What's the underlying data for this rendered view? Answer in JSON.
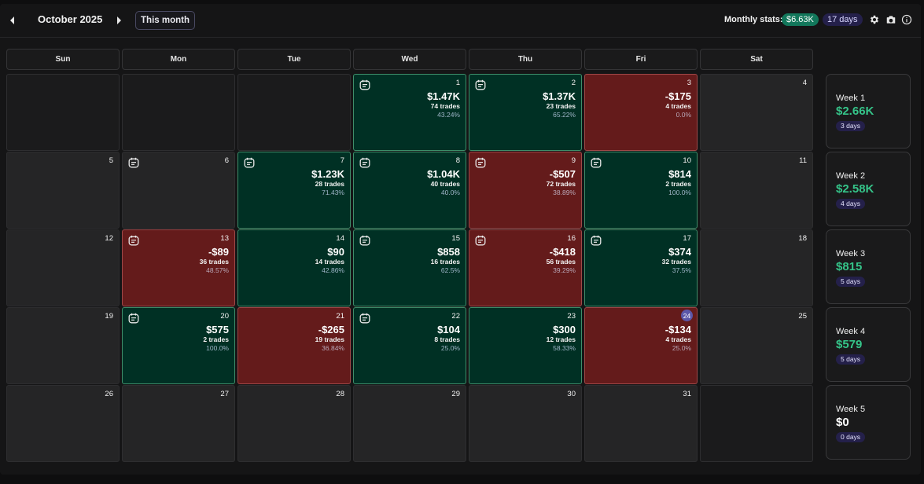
{
  "header": {
    "month_title": "October 2025",
    "this_month_label": "This month",
    "stats_label": "Monthly stats:",
    "stats_amount": "$6.63K",
    "stats_days": "17 days",
    "icons": [
      "caret-left-icon",
      "caret-right-icon",
      "gear-icon",
      "camera-icon",
      "info-icon"
    ]
  },
  "weekdays": [
    "Sun",
    "Mon",
    "Tue",
    "Wed",
    "Thu",
    "Fri",
    "Sat"
  ],
  "colors": {
    "profit_bg": "#003024",
    "loss_bg": "#641b1b",
    "profit_text": "#35c489",
    "badge_bg": "#24204a",
    "stats_pill_bg": "#12775b",
    "today_marker": "#5b57a8"
  },
  "weeks": [
    {
      "label": "Week 1",
      "amount": "$2.66K",
      "days": "3 days",
      "cells": [
        {
          "type": "blank"
        },
        {
          "type": "blank"
        },
        {
          "type": "blank"
        },
        {
          "type": "profit",
          "day": "1",
          "note": true,
          "pnl": "$1.47K",
          "trades": "74 trades",
          "winrate": "43.24%"
        },
        {
          "type": "profit",
          "day": "2",
          "note": true,
          "pnl": "$1.37K",
          "trades": "23 trades",
          "winrate": "65.22%"
        },
        {
          "type": "loss",
          "day": "3",
          "note": false,
          "pnl": "-$175",
          "trades": "4 trades",
          "winrate": "0.0%"
        },
        {
          "type": "empty",
          "day": "4"
        }
      ]
    },
    {
      "label": "Week 2",
      "amount": "$2.58K",
      "days": "4 days",
      "cells": [
        {
          "type": "empty",
          "day": "5"
        },
        {
          "type": "empty",
          "day": "6",
          "note": true
        },
        {
          "type": "profit",
          "day": "7",
          "note": true,
          "pnl": "$1.23K",
          "trades": "28 trades",
          "winrate": "71.43%"
        },
        {
          "type": "profit",
          "day": "8",
          "note": true,
          "pnl": "$1.04K",
          "trades": "40 trades",
          "winrate": "40.0%"
        },
        {
          "type": "loss",
          "day": "9",
          "note": true,
          "pnl": "-$507",
          "trades": "72 trades",
          "winrate": "38.89%"
        },
        {
          "type": "profit",
          "day": "10",
          "note": true,
          "pnl": "$814",
          "trades": "2 trades",
          "winrate": "100.0%"
        },
        {
          "type": "empty",
          "day": "11"
        }
      ]
    },
    {
      "label": "Week 3",
      "amount": "$815",
      "days": "5 days",
      "cells": [
        {
          "type": "empty",
          "day": "12"
        },
        {
          "type": "loss",
          "day": "13",
          "note": true,
          "pnl": "-$89",
          "trades": "36 trades",
          "winrate": "48.57%"
        },
        {
          "type": "profit",
          "day": "14",
          "note": false,
          "pnl": "$90",
          "trades": "14 trades",
          "winrate": "42.86%"
        },
        {
          "type": "profit",
          "day": "15",
          "note": true,
          "pnl": "$858",
          "trades": "16 trades",
          "winrate": "62.5%"
        },
        {
          "type": "loss",
          "day": "16",
          "note": true,
          "pnl": "-$418",
          "trades": "56 trades",
          "winrate": "39.29%"
        },
        {
          "type": "profit",
          "day": "17",
          "note": true,
          "pnl": "$374",
          "trades": "32 trades",
          "winrate": "37.5%"
        },
        {
          "type": "empty",
          "day": "18"
        }
      ]
    },
    {
      "label": "Week 4",
      "amount": "$579",
      "days": "5 days",
      "cells": [
        {
          "type": "empty",
          "day": "19"
        },
        {
          "type": "profit",
          "day": "20",
          "note": true,
          "pnl": "$575",
          "trades": "2 trades",
          "winrate": "100.0%"
        },
        {
          "type": "loss",
          "day": "21",
          "note": false,
          "pnl": "-$265",
          "trades": "19 trades",
          "winrate": "36.84%"
        },
        {
          "type": "profit",
          "day": "22",
          "note": true,
          "pnl": "$104",
          "trades": "8 trades",
          "winrate": "25.0%"
        },
        {
          "type": "profit",
          "day": "23",
          "note": false,
          "pnl": "$300",
          "trades": "12 trades",
          "winrate": "58.33%"
        },
        {
          "type": "loss",
          "day": "24",
          "today": true,
          "note": false,
          "pnl": "-$134",
          "trades": "4 trades",
          "winrate": "25.0%"
        },
        {
          "type": "empty",
          "day": "25"
        }
      ]
    },
    {
      "label": "Week 5",
      "amount": "$0",
      "days": "0 days",
      "cells": [
        {
          "type": "empty",
          "day": "26"
        },
        {
          "type": "empty",
          "day": "27"
        },
        {
          "type": "empty",
          "day": "28"
        },
        {
          "type": "empty",
          "day": "29"
        },
        {
          "type": "empty",
          "day": "30"
        },
        {
          "type": "empty",
          "day": "31"
        },
        {
          "type": "blank"
        }
      ]
    }
  ]
}
